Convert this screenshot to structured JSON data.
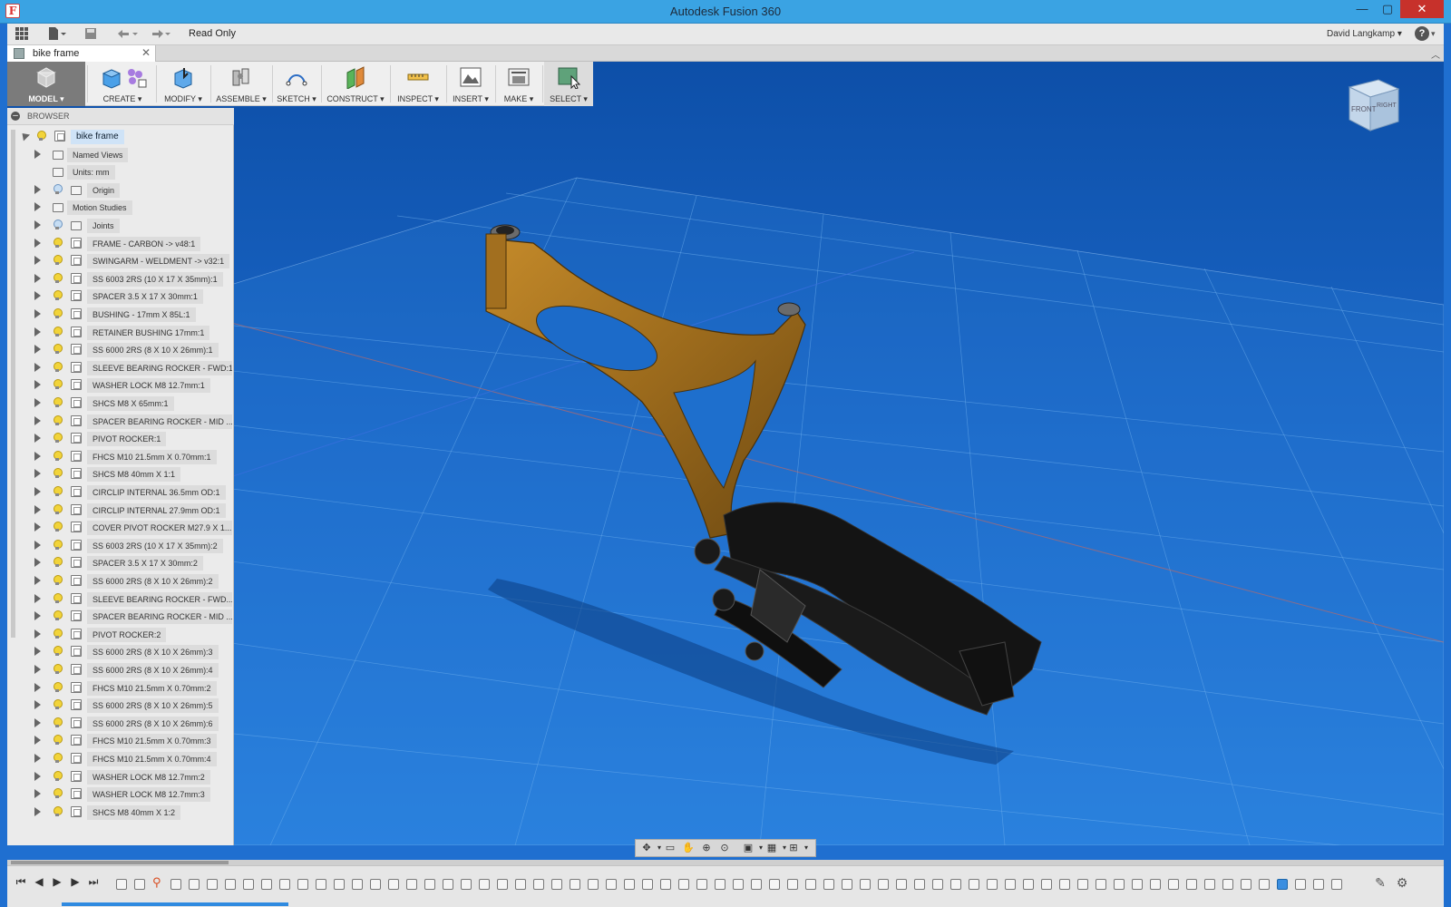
{
  "window": {
    "title": "Autodesk Fusion 360"
  },
  "appbar": {
    "read_only": "Read Only",
    "user": "David Langkamp ▾"
  },
  "doc_tab": {
    "name": "bike frame"
  },
  "toolbar": [
    {
      "id": "model",
      "label": "MODEL ▾"
    },
    {
      "id": "create",
      "label": "CREATE ▾"
    },
    {
      "id": "modify",
      "label": "MODIFY ▾"
    },
    {
      "id": "assemble",
      "label": "ASSEMBLE ▾"
    },
    {
      "id": "sketch",
      "label": "SKETCH ▾"
    },
    {
      "id": "construct",
      "label": "CONSTRUCT ▾"
    },
    {
      "id": "inspect",
      "label": "INSPECT ▾"
    },
    {
      "id": "insert",
      "label": "INSERT ▾"
    },
    {
      "id": "make",
      "label": "MAKE ▾"
    },
    {
      "id": "select",
      "label": "SELECT ▾"
    }
  ],
  "browser": {
    "title": "BROWSER",
    "root": "bike frame",
    "items": [
      "Named Views",
      "Units: mm",
      "Origin",
      "Motion Studies",
      "Joints",
      "FRAME - CARBON -> v48:1",
      "SWINGARM - WELDMENT -> v32:1",
      "SS 6003 2RS (10 X 17 X 35mm):1",
      "SPACER 3.5 X 17 X 30mm:1",
      "BUSHING - 17mm X 85L:1",
      "RETAINER BUSHING 17mm:1",
      "SS 6000 2RS (8 X 10 X 26mm):1",
      "SLEEVE BEARING ROCKER - FWD:1",
      "WASHER LOCK M8 12.7mm:1",
      "SHCS M8 X 65mm:1",
      "SPACER BEARING ROCKER - MID ...",
      "PIVOT ROCKER:1",
      "FHCS M10 21.5mm X 0.70mm:1",
      "SHCS M8 40mm X 1:1",
      "CIRCLIP INTERNAL 36.5mm OD:1",
      "CIRCLIP INTERNAL 27.9mm OD:1",
      "COVER PIVOT ROCKER M27.9 X 1...",
      "SS 6003 2RS (10 X 17 X 35mm):2",
      "SPACER 3.5 X 17 X 30mm:2",
      "SS 6000 2RS (8 X 10 X 26mm):2",
      "SLEEVE BEARING ROCKER - FWD...",
      "SPACER BEARING ROCKER - MID ...",
      "PIVOT ROCKER:2",
      "SS 6000 2RS (8 X 10 X 26mm):3",
      "SS 6000 2RS (8 X 10 X 26mm):4",
      "FHCS M10 21.5mm X 0.70mm:2",
      "SS 6000 2RS (8 X 10 X 26mm):5",
      "SS 6000 2RS (8 X 10 X 26mm):6",
      "FHCS M10 21.5mm X 0.70mm:3",
      "FHCS M10 21.5mm X 0.70mm:4",
      "WASHER LOCK M8 12.7mm:2",
      "WASHER LOCK M8 12.7mm:3",
      "SHCS M8 40mm X 1:2"
    ]
  },
  "viewcube": {
    "front": "FRONT",
    "right": "RIGHT"
  },
  "colors": {
    "accent": "#3aa3e3",
    "viewport": "#1a66c6",
    "frame": "#a8741e",
    "swingarm": "#151515"
  },
  "icons": [
    "apps-grid-icon",
    "file-icon",
    "save-icon",
    "undo-icon",
    "redo-icon",
    "help-icon",
    "orbit-icon",
    "pan-icon",
    "zoom-icon",
    "display-settings-icon",
    "grid-icon",
    "viewports-icon",
    "play-icon",
    "settings-icon"
  ]
}
